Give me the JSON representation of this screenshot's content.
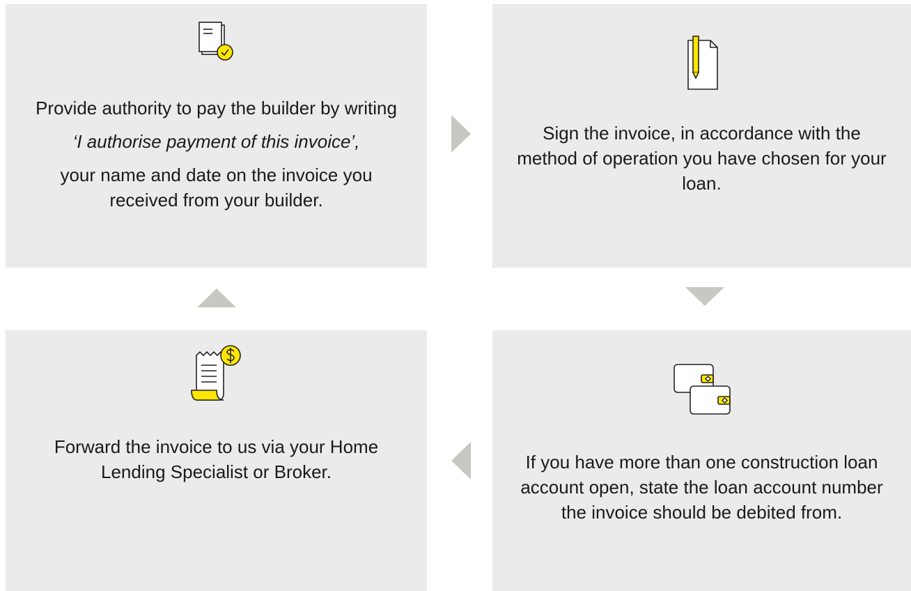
{
  "steps": [
    {
      "icon": "document-check-icon",
      "line1": "Provide authority to pay the builder by writing",
      "line2": "‘I authorise payment of this invoice’,",
      "line3": "your name and date on the invoice you received from your builder."
    },
    {
      "icon": "document-pen-icon",
      "line1": "Sign the invoice, in accordance with the method of operation you have chosen for your loan."
    },
    {
      "icon": "invoice-dollar-icon",
      "line1": "Forward the invoice to us via your Home Lending Specialist or Broker."
    },
    {
      "icon": "wallets-icon",
      "line1": "If you have more than one construction loan account open, state the loan account number the invoice should be debited from."
    }
  ],
  "colors": {
    "card_background": "#ebebeb",
    "accent": "#ffe600",
    "arrow": "#c8c8c2",
    "text": "#1a1a1a"
  }
}
